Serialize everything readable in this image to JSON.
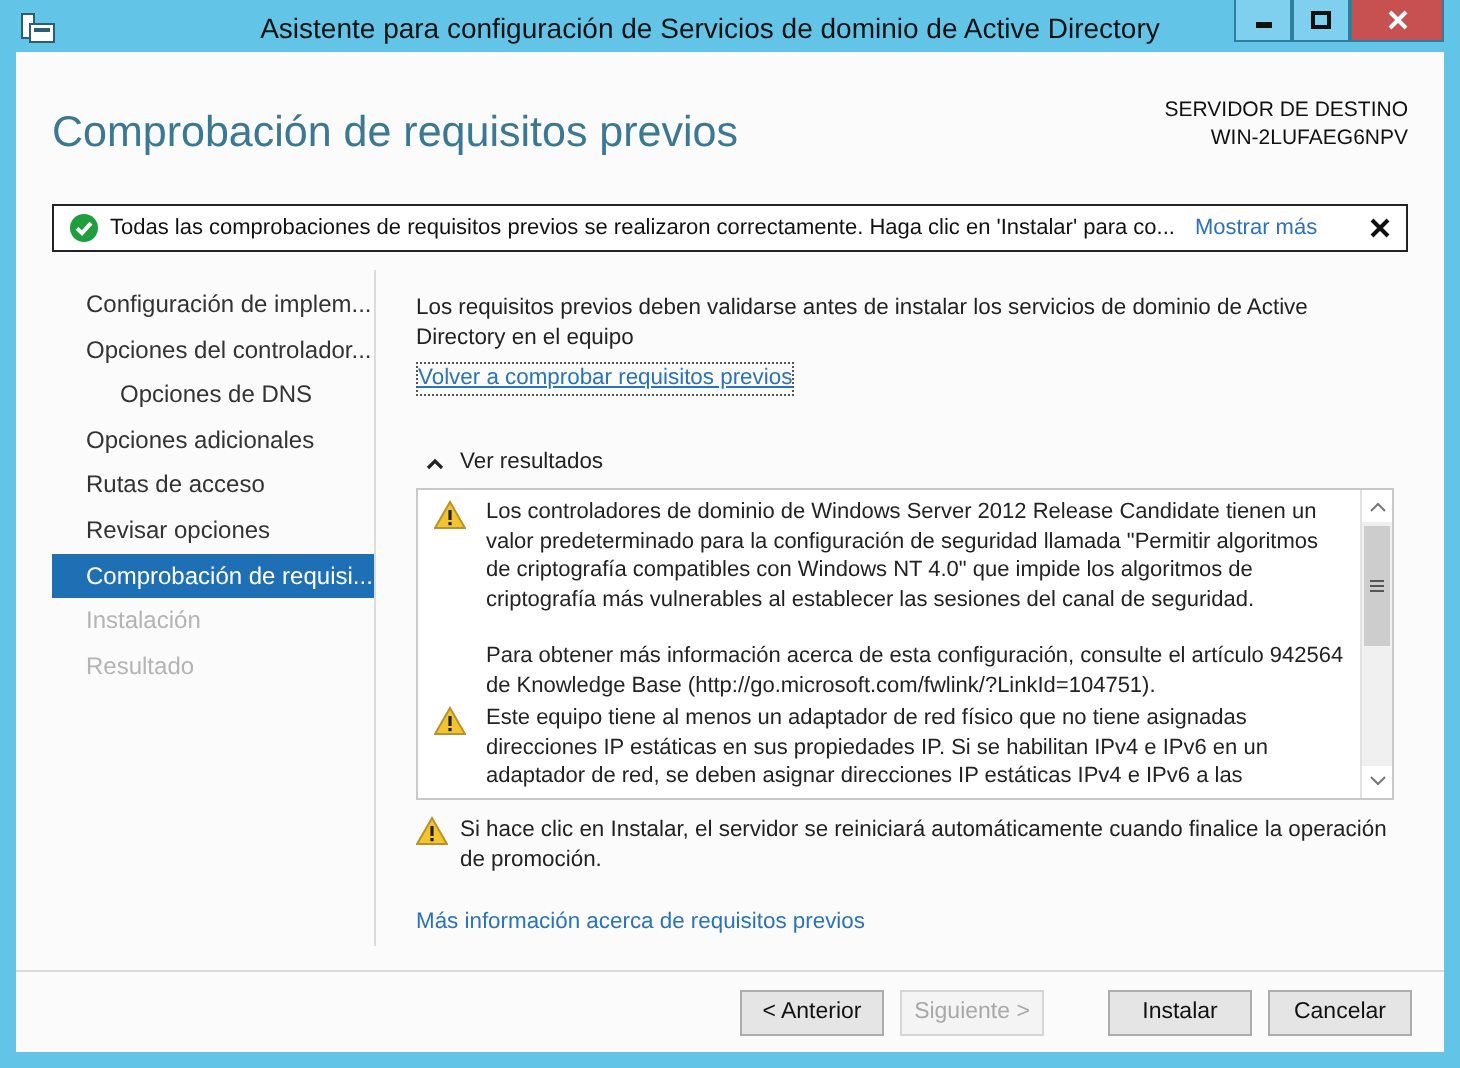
{
  "window": {
    "title": "Asistente para configuración de Servicios de dominio de Active Directory"
  },
  "header": {
    "title": "Comprobación de requisitos previos",
    "target_label": "SERVIDOR DE DESTINO",
    "target_server": "WIN-2LUFAEG6NPV"
  },
  "notification": {
    "message": "Todas las comprobaciones de requisitos previos se realizaron correctamente. Haga clic en 'Instalar' para co...",
    "link": "Mostrar más"
  },
  "nav": [
    {
      "label": "Configuración de implem...",
      "selected": false,
      "disabled": false
    },
    {
      "label": "Opciones del controlador...",
      "selected": false,
      "disabled": false,
      "children": [
        {
          "label": "Opciones de DNS",
          "selected": false,
          "disabled": false
        }
      ]
    },
    {
      "label": "Opciones adicionales",
      "selected": false,
      "disabled": false
    },
    {
      "label": "Rutas de acceso",
      "selected": false,
      "disabled": false
    },
    {
      "label": "Revisar opciones",
      "selected": false,
      "disabled": false
    },
    {
      "label": "Comprobación de requisi...",
      "selected": true,
      "disabled": false
    },
    {
      "label": "Instalación",
      "selected": false,
      "disabled": true
    },
    {
      "label": "Resultado",
      "selected": false,
      "disabled": true
    }
  ],
  "intro": "Los requisitos previos deben validarse antes de instalar los servicios de dominio de Active Directory en el equipo",
  "recheck_link": "Volver a comprobar requisitos previos",
  "results": {
    "toggle": "Ver resultados",
    "expanded": true,
    "items": [
      {
        "paragraphs": [
          "Los controladores de dominio de Windows Server 2012 Release Candidate tienen un valor predeterminado para la configuración de seguridad llamada \"Permitir algoritmos de criptografía compatibles con Windows NT 4.0\" que impide los algoritmos de criptografía más vulnerables al establecer las sesiones del canal de seguridad.",
          "Para obtener más información acerca de esta configuración, consulte el artículo 942564 de Knowledge Base (http://go.microsoft.com/fwlink/?LinkId=104751)."
        ]
      },
      {
        "paragraphs": [
          "Este equipo tiene al menos un adaptador de red físico que no tiene asignadas direcciones IP estáticas en sus propiedades IP. Si se habilitan IPv4 e IPv6 en un adaptador de red, se deben asignar direcciones IP estáticas IPv4 e IPv6 a las"
        ]
      }
    ]
  },
  "footer_warning": "Si hace clic en Instalar, el servidor se reiniciará automáticamente cuando finalice la operación de promoción.",
  "more_info_link": "Más información acerca de requisitos previos",
  "nav_buttons": [
    {
      "label": "< Anterior",
      "disabled": false
    },
    {
      "label": "Siguiente >",
      "disabled": true
    }
  ],
  "action_buttons": [
    {
      "label": "Instalar",
      "disabled": false
    },
    {
      "label": "Cancelar",
      "disabled": false
    }
  ]
}
